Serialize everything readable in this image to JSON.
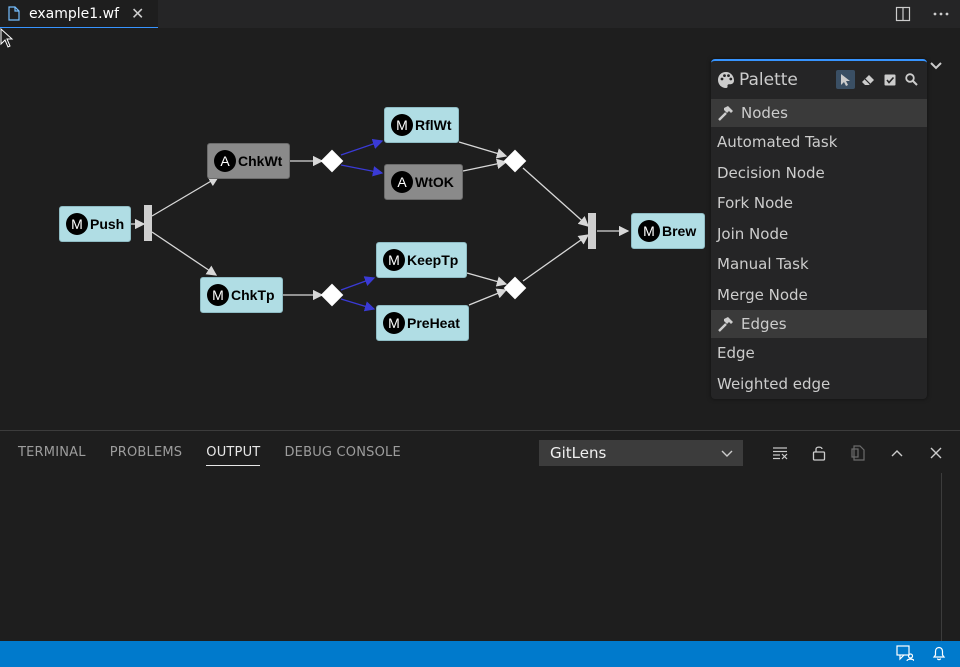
{
  "tab": {
    "filename": "example1.wf",
    "close_glyph": "✕"
  },
  "diagram": {
    "nodes": [
      {
        "id": "push",
        "kind": "manual",
        "badge": "M",
        "label": "Push"
      },
      {
        "id": "chkwt",
        "kind": "automated",
        "badge": "A",
        "label": "ChkWt"
      },
      {
        "id": "chktp",
        "kind": "manual",
        "badge": "M",
        "label": "ChkTp"
      },
      {
        "id": "rflwt",
        "kind": "manual",
        "badge": "M",
        "label": "RflWt"
      },
      {
        "id": "wtok",
        "kind": "automated",
        "badge": "A",
        "label": "WtOK"
      },
      {
        "id": "keeptp",
        "kind": "manual",
        "badge": "M",
        "label": "KeepTp"
      },
      {
        "id": "preheat",
        "kind": "manual",
        "badge": "M",
        "label": "PreHeat"
      },
      {
        "id": "brew",
        "kind": "manual",
        "badge": "M",
        "label": "Brew"
      }
    ]
  },
  "palette": {
    "title": "Palette",
    "groups": [
      {
        "label": "Nodes",
        "items": [
          "Automated Task",
          "Decision Node",
          "Fork Node",
          "Join Node",
          "Manual Task",
          "Merge Node"
        ]
      },
      {
        "label": "Edges",
        "items": [
          "Edge",
          "Weighted edge"
        ]
      }
    ]
  },
  "panel": {
    "tabs": [
      "TERMINAL",
      "PROBLEMS",
      "OUTPUT",
      "DEBUG CONSOLE"
    ],
    "active_tab": "OUTPUT",
    "output_channel": "GitLens"
  },
  "colors": {
    "accent": "#007acc",
    "manual_node": "#b0dde4",
    "automated_node": "#8a8a8a",
    "weighted_edge": "#3a3ad6"
  }
}
